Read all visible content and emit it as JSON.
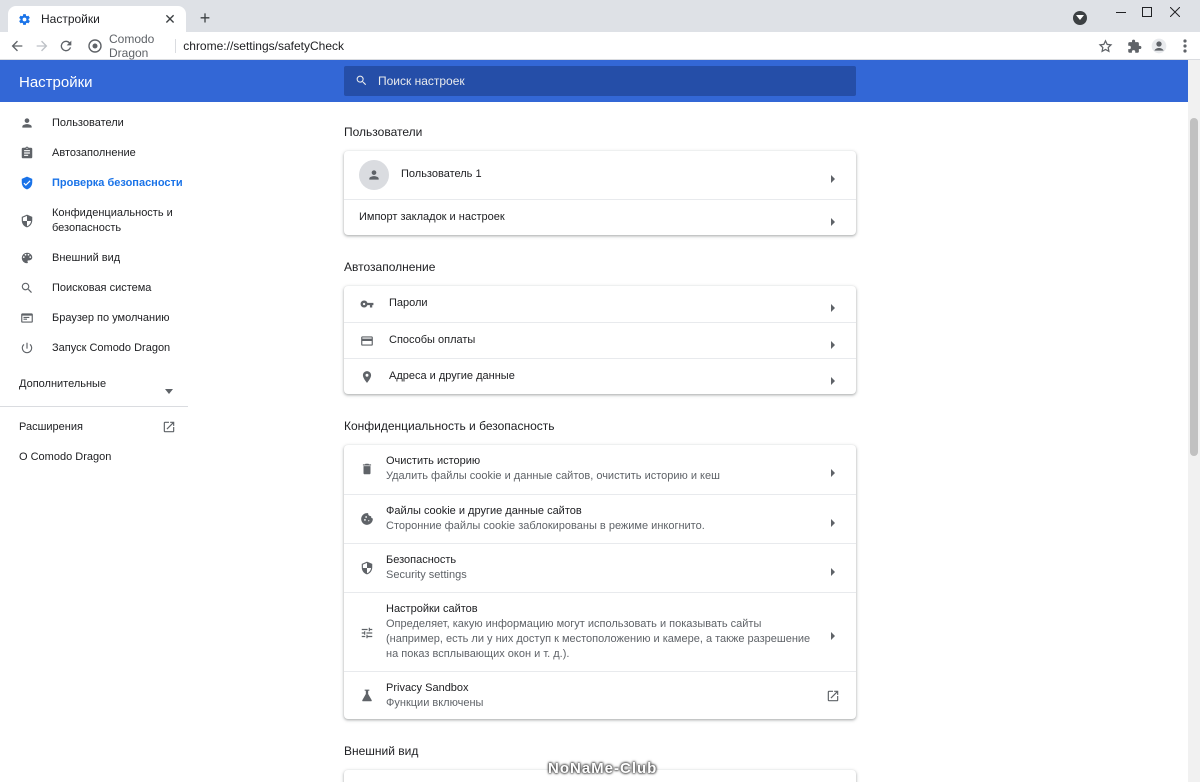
{
  "browser": {
    "tab_title": "Настройки",
    "tab_close": "✕",
    "new_tab": "+",
    "site_name": "Comodo Dragon",
    "url": "chrome://settings/safetyCheck"
  },
  "header": {
    "title": "Настройки",
    "search_placeholder": "Поиск настроек"
  },
  "sidebar": {
    "items": [
      {
        "label": "Пользователи",
        "icon": "person-icon"
      },
      {
        "label": "Автозаполнение",
        "icon": "clipboard-icon"
      },
      {
        "label": "Проверка безопасности",
        "icon": "shield-check-icon"
      },
      {
        "label": "Конфиденциальность и безопасность",
        "icon": "shield-icon"
      },
      {
        "label": "Внешний вид",
        "icon": "palette-icon"
      },
      {
        "label": "Поисковая система",
        "icon": "search-icon"
      },
      {
        "label": "Браузер по умолчанию",
        "icon": "browser-icon"
      },
      {
        "label": "Запуск Comodo Dragon",
        "icon": "power-icon"
      }
    ],
    "advanced_label": "Дополнительные",
    "extensions_label": "Расширения",
    "about_label": "О Comodo Dragon"
  },
  "sections": {
    "people": {
      "title": "Пользователи",
      "user_name": "Пользователь 1",
      "import_label": "Импорт закладок и настроек"
    },
    "autofill": {
      "title": "Автозаполнение",
      "passwords": "Пароли",
      "payments": "Способы оплаты",
      "addresses": "Адреса и другие данные"
    },
    "privacy": {
      "title": "Конфиденциальность и безопасность",
      "clear_title": "Очистить историю",
      "clear_sub": "Удалить файлы cookie и данные сайтов, очистить историю и кеш",
      "cookies_title": "Файлы cookie и другие данные сайтов",
      "cookies_sub": "Сторонние файлы cookie заблокированы в режиме инкогнито.",
      "security_title": "Безопасность",
      "security_sub": "Security settings",
      "site_title": "Настройки сайтов",
      "site_sub": "Определяет, какую информацию могут использовать и показывать сайты (например, есть ли у них доступ к местоположению и камере, а также разрешение на показ всплывающих окон и т. д.).",
      "sandbox_title": "Privacy Sandbox",
      "sandbox_sub": "Функции включены"
    },
    "appearance": {
      "title": "Внешний вид"
    }
  },
  "watermark": "NoNaMe-Club",
  "colors": {
    "accent": "#3367d6",
    "search_bg": "#254ea8",
    "active_nav": "#1a73e8"
  }
}
